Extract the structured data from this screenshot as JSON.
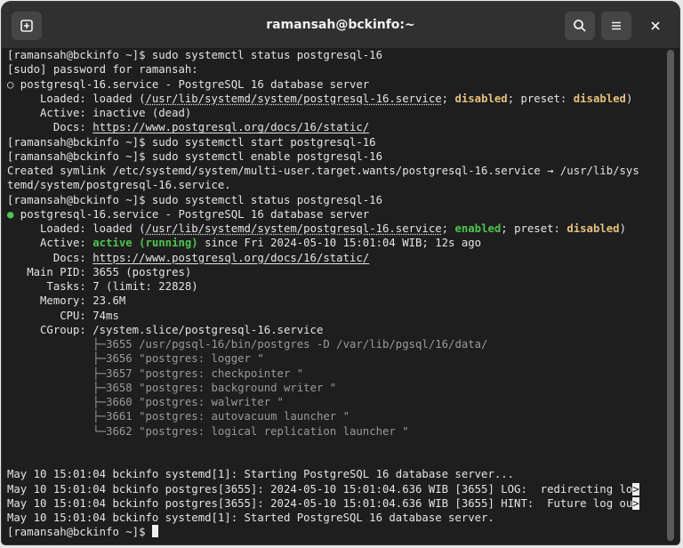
{
  "window": {
    "title": "ramansah@bckinfo:~"
  },
  "icons": {
    "new_tab": "new-tab-icon",
    "search": "search-icon",
    "menu": "hamburger-menu-icon",
    "close": "close-icon"
  },
  "colors": {
    "background": "#1e1e1e",
    "text": "#e4e4e4",
    "yellow": "#e5c07b",
    "green": "#4ec54e",
    "gray": "#9a9a9a",
    "titlebar": "#303030"
  },
  "terminal": {
    "l1": "[ramansah@bckinfo ~]$ sudo systemctl status postgresql-16",
    "l2": "[sudo] password for ramansah:",
    "l3": "○ postgresql-16.service - PostgreSQL 16 database server",
    "l4a": "     Loaded: loaded (",
    "l4b": "/usr/lib/systemd/system/postgresql-16.service",
    "l4c": "; ",
    "l4d": "disabled",
    "l4e": "; preset: ",
    "l4f": "disabled",
    "l4g": ")",
    "l5": "     Active: inactive (dead)",
    "l6a": "       Docs: ",
    "l6b": "https://www.postgresql.org/docs/16/static/",
    "l7": "[ramansah@bckinfo ~]$ sudo systemctl start postgresql-16",
    "l8": "[ramansah@bckinfo ~]$ sudo systemctl enable postgresql-16",
    "l9": "Created symlink /etc/systemd/system/multi-user.target.wants/postgresql-16.service → /usr/lib/sys",
    "l10": "temd/system/postgresql-16.service.",
    "l11": "[ramansah@bckinfo ~]$ sudo systemctl status postgresql-16",
    "l12a": "●",
    "l12b": " postgresql-16.service - PostgreSQL 16 database server",
    "l13a": "     Loaded: loaded (",
    "l13b": "/usr/lib/systemd/system/postgresql-16.service",
    "l13c": "; ",
    "l13d": "enabled",
    "l13e": "; preset: ",
    "l13f": "disabled",
    "l13g": ")",
    "l14a": "     Active: ",
    "l14b": "active (running)",
    "l14c": " since Fri 2024-05-10 15:01:04 WIB; 12s ago",
    "l15a": "       Docs: ",
    "l15b": "https://www.postgresql.org/docs/16/static/",
    "l16": "   Main PID: 3655 (postgres)",
    "l17": "      Tasks: 7 (limit: 22828)",
    "l18": "     Memory: 23.6M",
    "l19": "        CPU: 74ms",
    "l20": "     CGroup: /system.slice/postgresql-16.service",
    "l21a": "             ├─",
    "l21b": "3655 /usr/pgsql-16/bin/postgres -D /var/lib/pgsql/16/data/",
    "l22a": "             ├─",
    "l22b": "3656 \"postgres: logger \"",
    "l23a": "             ├─",
    "l23b": "3657 \"postgres: checkpointer \"",
    "l24a": "             ├─",
    "l24b": "3658 \"postgres: background writer \"",
    "l25a": "             ├─",
    "l25b": "3660 \"postgres: walwriter \"",
    "l26a": "             ├─",
    "l26b": "3661 \"postgres: autovacuum launcher \"",
    "l27a": "             └─",
    "l27b": "3662 \"postgres: logical replication launcher \"",
    "l28": "",
    "l29": "May 10 15:01:04 bckinfo systemd[1]: Starting PostgreSQL 16 database server...",
    "l30a": "May 10 15:01:04 bckinfo postgres[3655]: 2024-05-10 15:01:04.636 WIB [3655] LOG:  redirecting lo",
    "l31a": "May 10 15:01:04 bckinfo postgres[3655]: 2024-05-10 15:01:04.636 WIB [3655] HINT:  Future log ou",
    "trunc": ">",
    "l32": "May 10 15:01:04 bckinfo systemd[1]: Started PostgreSQL 16 database server.",
    "l33": "[ramansah@bckinfo ~]$ "
  }
}
